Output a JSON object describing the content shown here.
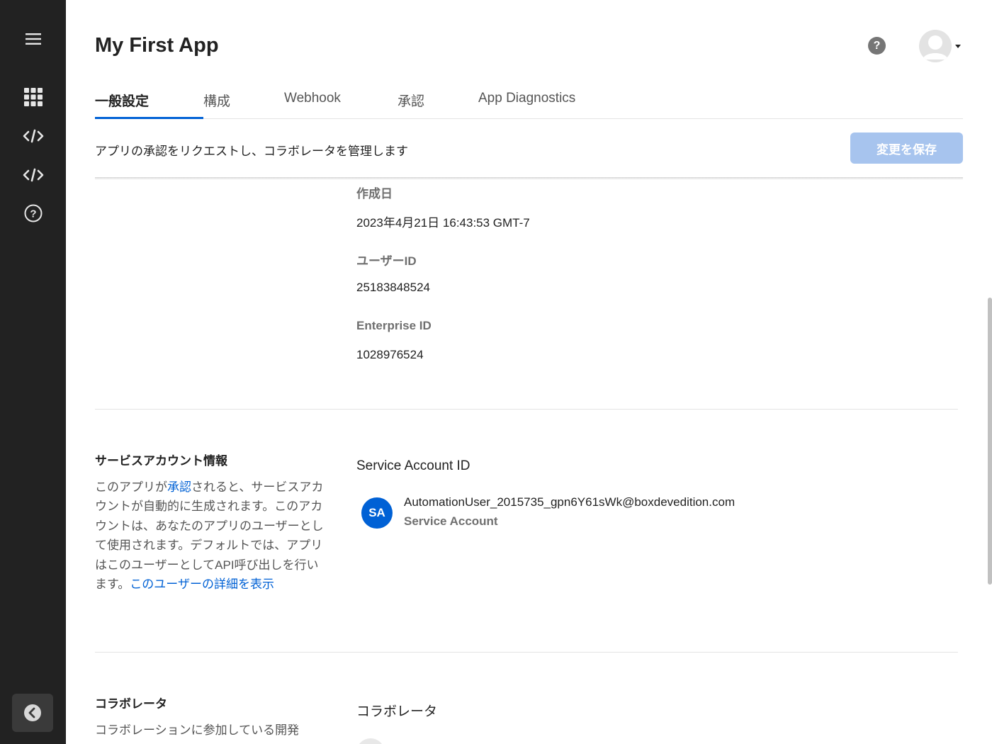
{
  "sidebar": {
    "nav": [
      {
        "icon": "menu-icon"
      },
      {
        "icon": "apps-grid-icon"
      },
      {
        "icon": "code-icon"
      },
      {
        "icon": "code-icon"
      },
      {
        "icon": "help-circle-icon"
      }
    ],
    "collapse_icon": "chevron-left-icon"
  },
  "header": {
    "title": "My First App",
    "help_label": "?"
  },
  "tabs": [
    {
      "label": "一般設定",
      "active": true
    },
    {
      "label": "構成",
      "active": false
    },
    {
      "label": "Webhook",
      "active": false
    },
    {
      "label": "承認",
      "active": false
    },
    {
      "label": "App Diagnostics",
      "active": false
    }
  ],
  "subheader": {
    "description": "アプリの承認をリクエストし、コラボレータを管理します",
    "save_label": "変更を保存"
  },
  "app_info": {
    "created_label": "作成日",
    "created_value": "2023年4月21日 16:43:53 GMT-7",
    "user_id_label": "ユーザーID",
    "user_id_value": "25183848524",
    "enterprise_id_label": "Enterprise ID",
    "enterprise_id_value": "1028976524"
  },
  "service_account": {
    "section_title": "サービスアカウント情報",
    "desc_part1": "このアプリが",
    "desc_link1": "承認",
    "desc_part2": "されると、サービスアカウントが自動的に生成されます。このアカウントは、あなたのアプリのユーザーとして使用されます。デフォルトでは、アプリはこのユーザーとしてAPI呼び出しを行います。",
    "desc_link2": "このユーザーの詳細を表示",
    "id_heading": "Service Account ID",
    "avatar_initials": "SA",
    "email": "AutomationUser_2015735_gpn6Y61sWk@boxdevedition.com",
    "type": "Service Account"
  },
  "collaborators": {
    "section_title": "コラボレータ",
    "desc": "コラボレーションに参加している開発",
    "heading": "コラボレータ"
  },
  "colors": {
    "sidebar_bg": "#222222",
    "accent": "#0061d5",
    "save_disabled": "#a7c4ee"
  }
}
